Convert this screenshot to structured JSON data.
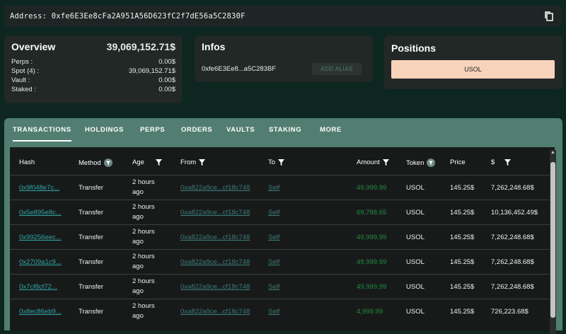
{
  "address": {
    "label": "Address:",
    "value": "0xfe6E3Ee8cFa2A951A56D623fC2f7dE56a5C2830F",
    "copy_icon": "copy-icon"
  },
  "overview": {
    "title": "Overview",
    "total": "39,069,152.71$",
    "rows": [
      {
        "label": "Perps :",
        "value": "0.00$"
      },
      {
        "label": "Spot (4) :",
        "value": "39,069,152.71$"
      },
      {
        "label": "Vault :",
        "value": "0.00$"
      },
      {
        "label": "Staked :",
        "value": "0.00$"
      }
    ]
  },
  "infos": {
    "title": "Infos",
    "short_address": "0xfe6E3Ee8...a5C283BF",
    "alias_button": "ADD ALIAS"
  },
  "positions": {
    "title": "Positions",
    "token": "USOL"
  },
  "tabs": [
    "TRANSACTIONS",
    "HOLDINGS",
    "PERPS",
    "ORDERS",
    "VAULTS",
    "STAKING",
    "MORE"
  ],
  "active_tab": "TRANSACTIONS",
  "table": {
    "headers": {
      "hash": "Hash",
      "method": "Method",
      "age": "Age",
      "from": "From",
      "to": "To",
      "amount": "Amount",
      "token": "Token",
      "price": "Price",
      "usd": "$"
    },
    "rows": [
      {
        "hash": "0x9f048e7c...",
        "method": "Transfer",
        "age1": "2 hours",
        "age2": "ago",
        "from": "0xa822a9ce...cf18c748",
        "to": "Self",
        "amount": "49,999.99",
        "token": "USOL",
        "price": "145.25$",
        "usd": "7,262,248.68$"
      },
      {
        "hash": "0x5e895e8c...",
        "method": "Transfer",
        "age1": "2 hours",
        "age2": "ago",
        "from": "0xa822a9ce...cf18c748",
        "to": "Self",
        "amount": "69,788.65",
        "token": "USOL",
        "price": "145.25$",
        "usd": "10,136,452.49$"
      },
      {
        "hash": "0x99256eec...",
        "method": "Transfer",
        "age1": "2 hours",
        "age2": "ago",
        "from": "0xa822a9ce...cf18c748",
        "to": "Self",
        "amount": "49,999.99",
        "token": "USOL",
        "price": "145.25$",
        "usd": "7,262,248.68$"
      },
      {
        "hash": "0x2709a1c9...",
        "method": "Transfer",
        "age1": "2 hours",
        "age2": "ago",
        "from": "0xa822a9ce...cf18c748",
        "to": "Self",
        "amount": "49,999.99",
        "token": "USOL",
        "price": "145.25$",
        "usd": "7,262,248.68$"
      },
      {
        "hash": "0x7cf8cf72...",
        "method": "Transfer",
        "age1": "2 hours",
        "age2": "ago",
        "from": "0xa822a9ce...cf18c748",
        "to": "Self",
        "amount": "49,999.99",
        "token": "USOL",
        "price": "145.25$",
        "usd": "7,262,248.68$"
      },
      {
        "hash": "0x8ec86eb9...",
        "method": "Transfer",
        "age1": "2 hours",
        "age2": "ago",
        "from": "0xa822a9ce...cf18c748",
        "to": "Self",
        "amount": "4,999.99",
        "token": "USOL",
        "price": "145.25$",
        "usd": "726,223.68$"
      }
    ]
  },
  "colors": {
    "background": "#0d2620",
    "card": "#212826",
    "tab_bar": "#517e70",
    "position_chip": "#f8d3bc",
    "link": "#2fa6a6",
    "amount": "#1c8f3e"
  }
}
